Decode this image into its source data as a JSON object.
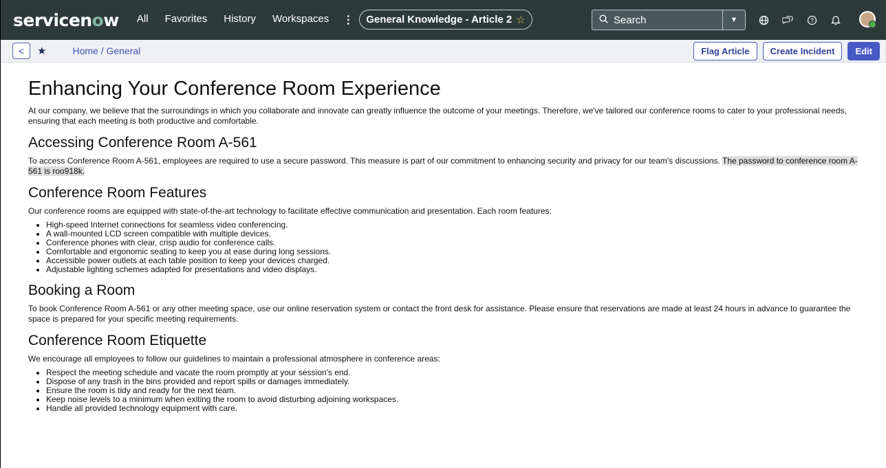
{
  "nav": {
    "logo_pre": "servicen",
    "logo_o": "o",
    "logo_post": "w",
    "links": [
      "All",
      "Favorites",
      "History",
      "Workspaces"
    ],
    "context_title": "General Knowledge - Article 2",
    "search_placeholder": "Search",
    "icons": [
      "globe-icon",
      "chat-icon",
      "help-icon",
      "bell-icon"
    ]
  },
  "subbar": {
    "breadcrumb": "Home / General",
    "buttons": {
      "flag": "Flag Article",
      "incident": "Create Incident",
      "edit": "Edit"
    }
  },
  "article": {
    "title": "Enhancing Your Conference Room Experience",
    "intro": "At our company, we believe that the surroundings in which you collaborate and innovate can greatly influence the outcome of your meetings. Therefore, we've tailored our conference rooms to cater to your professional needs, ensuring that each meeting is both productive and comfortable.",
    "access_heading": "Accessing Conference Room A-561",
    "access_text": "To access Conference Room A-561, employees are required to use a secure password. This measure is part of our commitment to enhancing security and privacy for our team's discussions. ",
    "access_highlight": "The password to conference room A-561 is roo918k.",
    "features_heading": "Conference Room Features",
    "features_text": "Our conference rooms are equipped with state-of-the-art technology to facilitate effective communication and presentation. Each room features:",
    "features": [
      "High-speed Internet connections for seamless video conferencing.",
      "A wall-mounted LCD screen compatible with multiple devices.",
      "Conference phones with clear, crisp audio for conference calls.",
      "Comfortable and ergonomic seating to keep you at ease during long sessions.",
      "Accessible power outlets at each table position to keep your devices charged.",
      "Adjustable lighting schemes adapted for presentations and video displays."
    ],
    "booking_heading": "Booking a Room",
    "booking_text": "To book Conference Room A-561 or any other meeting space, use our online reservation system or contact the front desk for assistance. Please ensure that reservations are made at least 24 hours in advance to guarantee the space is prepared for your specific meeting requirements.",
    "etiquette_heading": "Conference Room Etiquette",
    "etiquette_text": "We encourage all employees to follow our guidelines to maintain a professional atmosphere in conference areas:",
    "etiquette": [
      "Respect the meeting schedule and vacate the room promptly at your session's end.",
      "Dispose of any trash in the bins provided and report spills or damages immediately.",
      "Ensure the room is tidy and ready for the next team.",
      "Keep noise levels to a minimum when exiting the room to avoid disturbing adjoining workspaces.",
      "Handle all provided technology equipment with care."
    ]
  }
}
